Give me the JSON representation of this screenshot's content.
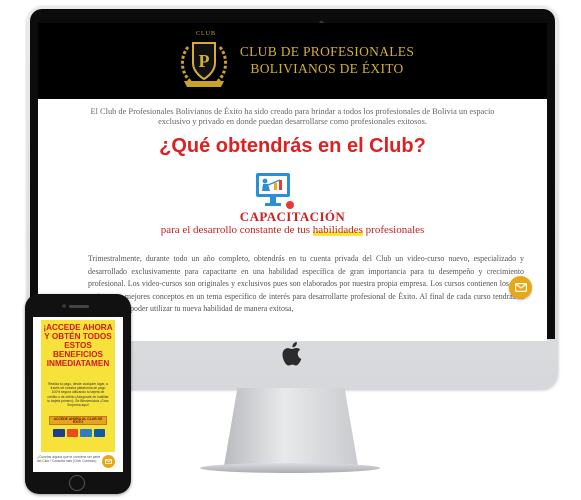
{
  "header": {
    "emblem_top": "CLUB",
    "emblem_letter": "P",
    "title_line1": "CLUB DE PROFESIONALES",
    "title_line2": "BOLIVIANOS DE ÉXITO"
  },
  "intro": "El Club de Profesionales Bolivianos de Éxito ha sido creado para brindar a todos los profesionales de Bolivia un espacio exclusivo y privado en donde puedan desarrollarse como profesionales exitosos.",
  "section_heading": "¿Qué obtendrás en el Club?",
  "benefit": {
    "icon": "training-icon",
    "title": "CAPACITACIÓN",
    "subtitle_before": "para el desarrollo constante de tus ",
    "subtitle_highlight": "habilidades",
    "subtitle_after": " profesionales"
  },
  "body_text": "Trimestralmente, durante todo un año completo, obtendrás en tu cuenta privada del Club un video-curso nuevo, especializado y desarrollado exclusivamente para capacitarte en una habilidad específica de gran importancia para tu desempeño y crecimiento profesional. Los video-cursos son originales y exclusivos pues son elaborados por nuestra propia empresa. Los cursos contienen los más recientes y mejores conceptos en un tema específico de interés para desarrollarte profesional de Éxito. Al final de cada curso tendrás la seguridad de poder utilizar tu nueva habilidad de manera exitosa,",
  "mail_icon": "envelope-icon",
  "phone": {
    "headline": "¡ACCEDE AHORA Y OBTÉN TODOS ESTOS BENEFICIOS INMEDIATAMEN",
    "body": "Realiza tu pago, desde cualquier lugar, a través de nuestra plataforma de pago 100% segura utilizando tu tarjeta de crédito o de débito (Asegúrate de habilitar tu tarjeta primero). Sé Bienvenido/a ¡Gran Sorpresa aquí!",
    "cta": "ACCEDE AHORA AL CLUB DE ÉXITO",
    "question": "¿Cuentas alguna que te conviene ser parte del Club? Consulta más (Click Contacto)"
  },
  "colors": {
    "gold": "#d4af37",
    "heading_red": "#e02020",
    "promo_yellow": "#f6e23a",
    "accent_orange": "#e6a817"
  }
}
